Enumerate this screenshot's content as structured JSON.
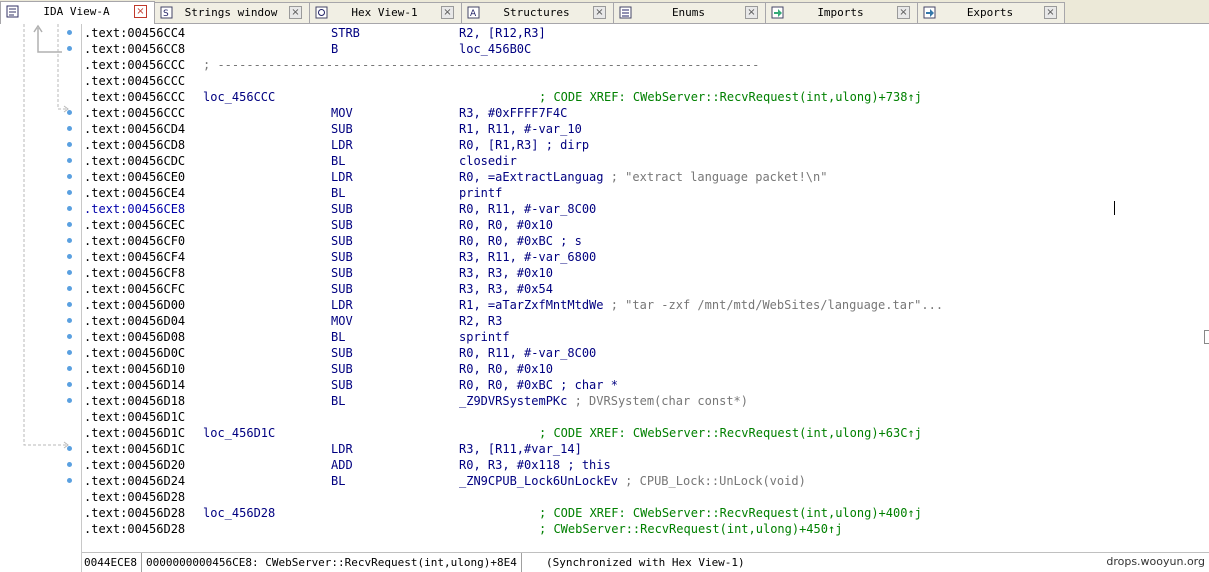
{
  "tabs": [
    {
      "label": "IDA View-A",
      "icon": "ida-view-icon",
      "active": true
    },
    {
      "label": "Strings window",
      "icon": "strings-icon",
      "active": false
    },
    {
      "label": "Hex View-1",
      "icon": "hex-view-icon",
      "active": false
    },
    {
      "label": "Structures",
      "icon": "structures-icon",
      "active": false
    },
    {
      "label": "Enums",
      "icon": "enums-icon",
      "active": false
    },
    {
      "label": "Imports",
      "icon": "imports-icon",
      "active": false
    },
    {
      "label": "Exports",
      "icon": "exports-icon",
      "active": false
    }
  ],
  "close_glyph": "×",
  "rows": [
    {
      "addr": ".text:00456CC4",
      "mn": "STRB",
      "op": "R2, [R12,R3]"
    },
    {
      "addr": ".text:00456CC8",
      "mn": "B",
      "op": "loc_456B0C"
    },
    {
      "addr": ".text:00456CCC",
      "sep": "; ---------------------------------------------------------------------------"
    },
    {
      "addr": ".text:00456CCC"
    },
    {
      "addr": ".text:00456CCC",
      "label": "loc_456CCC",
      "xref": "; CODE XREF: CWebServer::RecvRequest(int,ulong)+738↑j"
    },
    {
      "addr": ".text:00456CCC",
      "mn": "MOV",
      "op": "R3, #0xFFFF7F4C"
    },
    {
      "addr": ".text:00456CD4",
      "mn": "SUB",
      "op": "R1, R11, #-var_10"
    },
    {
      "addr": ".text:00456CD8",
      "mn": "LDR",
      "op": "R0, [R1,R3] ; dirp"
    },
    {
      "addr": ".text:00456CDC",
      "mn": "BL",
      "op": "closedir"
    },
    {
      "addr": ".text:00456CE0",
      "mn": "LDR",
      "op": "R0, =aExtractLanguag",
      "cmt": " ; \"extract language packet!\\n\""
    },
    {
      "addr": ".text:00456CE4",
      "mn": "BL",
      "op": "printf"
    },
    {
      "addr": ".text:00456CE8",
      "mn": "SUB",
      "op": "R0, R11, #-var_8C00",
      "hl": true
    },
    {
      "addr": ".text:00456CEC",
      "mn": "SUB",
      "op": "R0, R0, #0x10"
    },
    {
      "addr": ".text:00456CF0",
      "mn": "SUB",
      "op": "R0, R0, #0xBC ; s"
    },
    {
      "addr": ".text:00456CF4",
      "mn": "SUB",
      "op": "R3, R11, #-var_6800"
    },
    {
      "addr": ".text:00456CF8",
      "mn": "SUB",
      "op": "R3, R3, #0x10"
    },
    {
      "addr": ".text:00456CFC",
      "mn": "SUB",
      "op": "R3, R3, #0x54"
    },
    {
      "addr": ".text:00456D00",
      "mn": "LDR",
      "op": "R1, =aTarZxfMntMtdWe",
      "cmt": " ; \"tar -zxf /mnt/mtd/WebSites/language.tar\"..."
    },
    {
      "addr": ".text:00456D04",
      "mn": "MOV",
      "op": "R2, R3"
    },
    {
      "addr": ".text:00456D08",
      "mn": "BL",
      "op": "sprintf"
    },
    {
      "addr": ".text:00456D0C",
      "mn": "SUB",
      "op": "R0, R11, #-var_8C00"
    },
    {
      "addr": ".text:00456D10",
      "mn": "SUB",
      "op": "R0, R0, #0x10"
    },
    {
      "addr": ".text:00456D14",
      "mn": "SUB",
      "op": "R0, R0, #0xBC ; char *"
    },
    {
      "addr": ".text:00456D18",
      "mn": "BL",
      "op": "_Z9DVRSystemPKc",
      "cmt": " ; DVRSystem(char const*)"
    },
    {
      "addr": ".text:00456D1C"
    },
    {
      "addr": ".text:00456D1C",
      "label": "loc_456D1C",
      "xref": "; CODE XREF: CWebServer::RecvRequest(int,ulong)+63C↑j"
    },
    {
      "addr": ".text:00456D1C",
      "mn": "LDR",
      "op": "R3, [R11,#var_14]"
    },
    {
      "addr": ".text:00456D20",
      "mn": "ADD",
      "op": "R0, R3, #0x118 ; this"
    },
    {
      "addr": ".text:00456D24",
      "mn": "BL",
      "op": "_ZN9CPUB_Lock6UnLockEv",
      "cmt": " ; CPUB_Lock::UnLock(void)"
    },
    {
      "addr": ".text:00456D28"
    },
    {
      "addr": ".text:00456D28",
      "label": "loc_456D28",
      "xref": "; CODE XREF: CWebServer::RecvRequest(int,ulong)+400↑j"
    },
    {
      "addr": ".text:00456D28",
      "xref": "; CWebServer::RecvRequest(int,ulong)+450↑j"
    }
  ],
  "status": {
    "offset": "0044ECE8",
    "location": "0000000000456CE8: CWebServer::RecvRequest(int,ulong)+8E4",
    "sync": "(Synchronized with Hex View-1)"
  },
  "watermark": "drops.wooyun.org",
  "colors": {
    "address": "#000000",
    "code": "#000080",
    "xref": "#008000",
    "comment": "#777777",
    "gutter_dot": "#5aa0e0"
  }
}
